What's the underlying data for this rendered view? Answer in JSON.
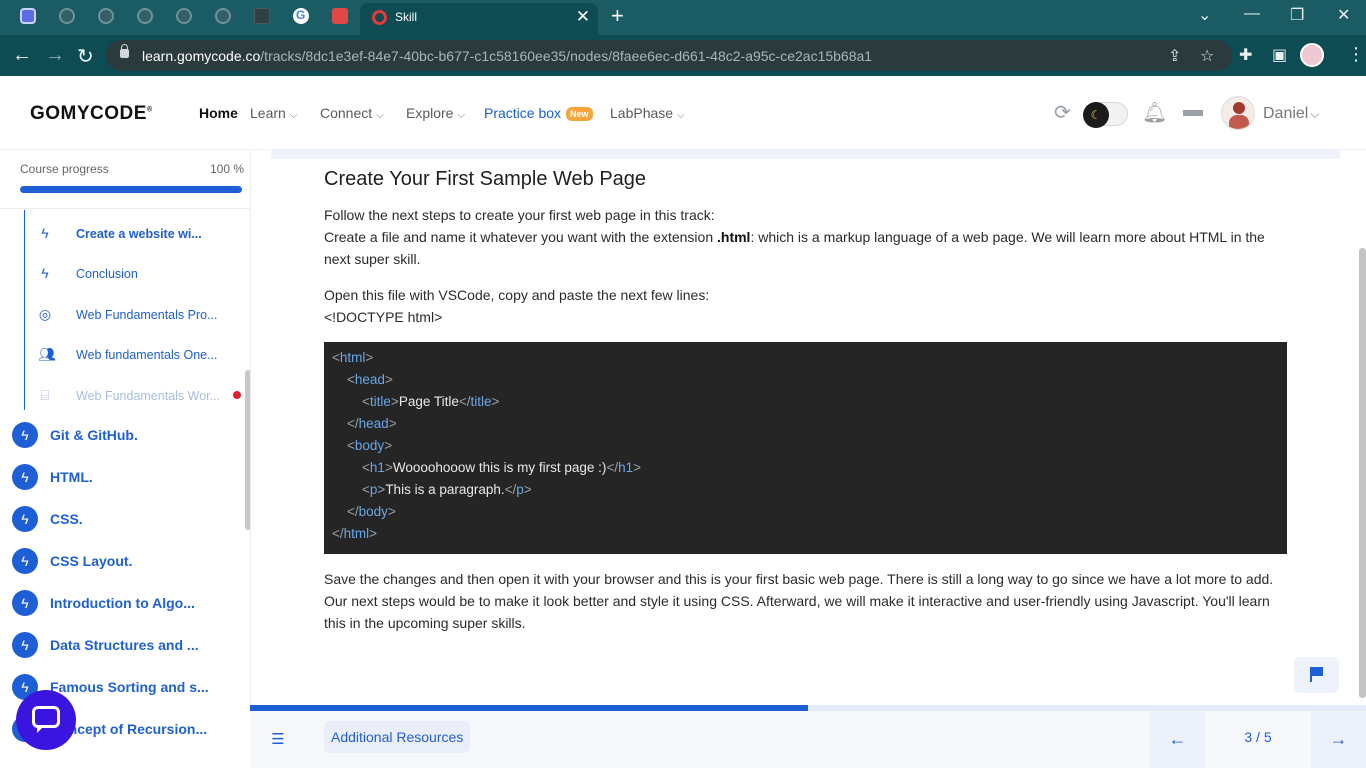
{
  "browser": {
    "active_tab_title": "Skill",
    "url_host": "learn.gomycode.co",
    "url_path": "/tracks/8dc1e3ef-84e7-40bc-b677-c1c58160ee35/nodes/8faee6ec-d661-48c2-a95c-ce2ac15b68a1"
  },
  "header": {
    "logo": "GOMYCODE",
    "nav": {
      "home": "Home",
      "learn": "Learn",
      "connect": "Connect",
      "explore": "Explore",
      "practice": "Practice box",
      "practice_badge": "New",
      "labphase": "LabPhase"
    },
    "username": "Daniel",
    "dark_mode": "on"
  },
  "sidebar": {
    "progress_label": "Course progress",
    "progress_value": "100 %",
    "progress_fraction": 1.0,
    "sub_items": [
      {
        "label": "Create a website wi...",
        "icon": "bolt-icon"
      },
      {
        "label": "Conclusion",
        "icon": "bolt-icon"
      },
      {
        "label": "Web Fundamentals Pro...",
        "icon": "target-icon"
      },
      {
        "label": "Web fundamentals One...",
        "icon": "people-icon"
      },
      {
        "label": "Web Fundamentals Wor...",
        "icon": "workshop-icon"
      }
    ],
    "sections": [
      {
        "label": "Git & GitHub."
      },
      {
        "label": "HTML."
      },
      {
        "label": "CSS."
      },
      {
        "label": "CSS Layout."
      },
      {
        "label": "Introduction to Algo..."
      },
      {
        "label": "Data Structures and ..."
      },
      {
        "label": "Famous Sorting and s..."
      },
      {
        "label": "Concept of Recursion..."
      }
    ]
  },
  "content": {
    "title": "Create Your First Sample Web Page",
    "p1_line1": "Follow the next steps to create your first web page in this track:",
    "p1_line2_pre": "Create a file and name it whatever you want with the extension ",
    "p1_line2_bold": ".html",
    "p1_line2_post": ": which is a markup language of a web page. We will learn more about HTML in the next super skill.",
    "p2_line1": "Open this file with VSCode, copy and paste the next few lines:",
    "p2_line2": "<!DOCTYPE html>",
    "code": {
      "title_text": "Page Title",
      "h1_text": "Woooohooow this is my first page :)",
      "p_text": "This is a paragraph."
    },
    "p3": "Save the changes and then open it with your browser and this is your first basic web page. There is still a long way to go since we have a lot more to add. Our next steps would be to make it look better and style it using CSS. Afterward, we will make it interactive and user-friendly using Javascript. You'll learn this in the upcoming super skills."
  },
  "footer": {
    "resources_label": "Additional Resources",
    "page_indicator": "3 / 5",
    "lesson_progress_fraction": 0.5
  }
}
